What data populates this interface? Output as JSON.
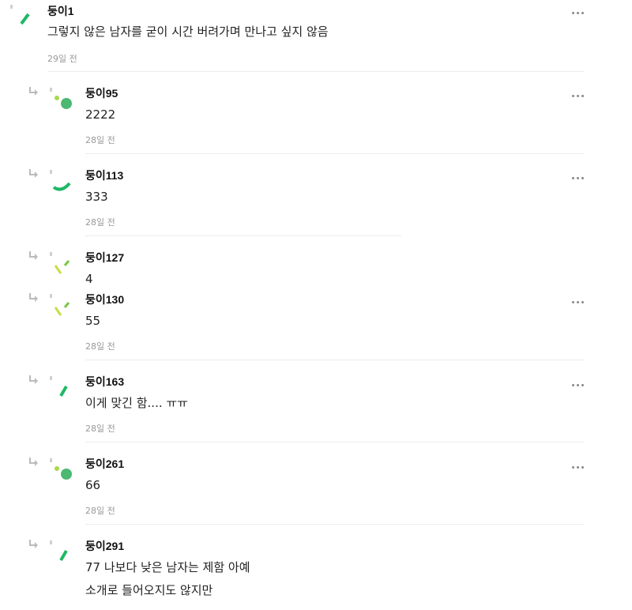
{
  "colors": {
    "accent_green": "#1fb866",
    "lime": "#a8d94a",
    "divider": "#ececec",
    "time_gray": "#999999"
  },
  "icons": {
    "reply": "reply-arrow-icon",
    "more": "more-options-icon"
  },
  "comments": [
    {
      "id": "c1",
      "nickname": "둥이1",
      "lines": [
        "그렇지 않은 남자를 굳이 시간 버려가며 만나고 싶지 않음"
      ],
      "time": "29일 전",
      "is_reply": false,
      "avatar": "dash-green"
    },
    {
      "id": "c2",
      "nickname": "둥이95",
      "lines": [
        "2222"
      ],
      "time": "28일 전",
      "is_reply": true,
      "avatar": "dot-circle-green"
    },
    {
      "id": "c3",
      "nickname": "둥이113",
      "lines": [
        "333"
      ],
      "time": "28일 전",
      "is_reply": true,
      "avatar": "arc-green"
    },
    {
      "id": "c4",
      "nickname": "둥이127",
      "lines": [
        "4"
      ],
      "time": "",
      "is_reply": true,
      "avatar": "check-lime"
    },
    {
      "id": "c5",
      "nickname": "둥이130",
      "lines": [
        "55"
      ],
      "time": "28일 전",
      "is_reply": true,
      "avatar": "check-lime"
    },
    {
      "id": "c6",
      "nickname": "둥이163",
      "lines": [
        "이게 맞긴 함.... ㅠㅠ"
      ],
      "time": "28일 전",
      "is_reply": true,
      "avatar": "dash-green"
    },
    {
      "id": "c7",
      "nickname": "둥이261",
      "lines": [
        "66"
      ],
      "time": "28일 전",
      "is_reply": true,
      "avatar": "dot-circle-green"
    },
    {
      "id": "c8",
      "nickname": "둥이291",
      "lines": [
        "77 나보다 낮은 남자는 제함 아예",
        "소개로 들어오지도 않지만"
      ],
      "time": "",
      "is_reply": true,
      "avatar": "dash-green"
    }
  ]
}
